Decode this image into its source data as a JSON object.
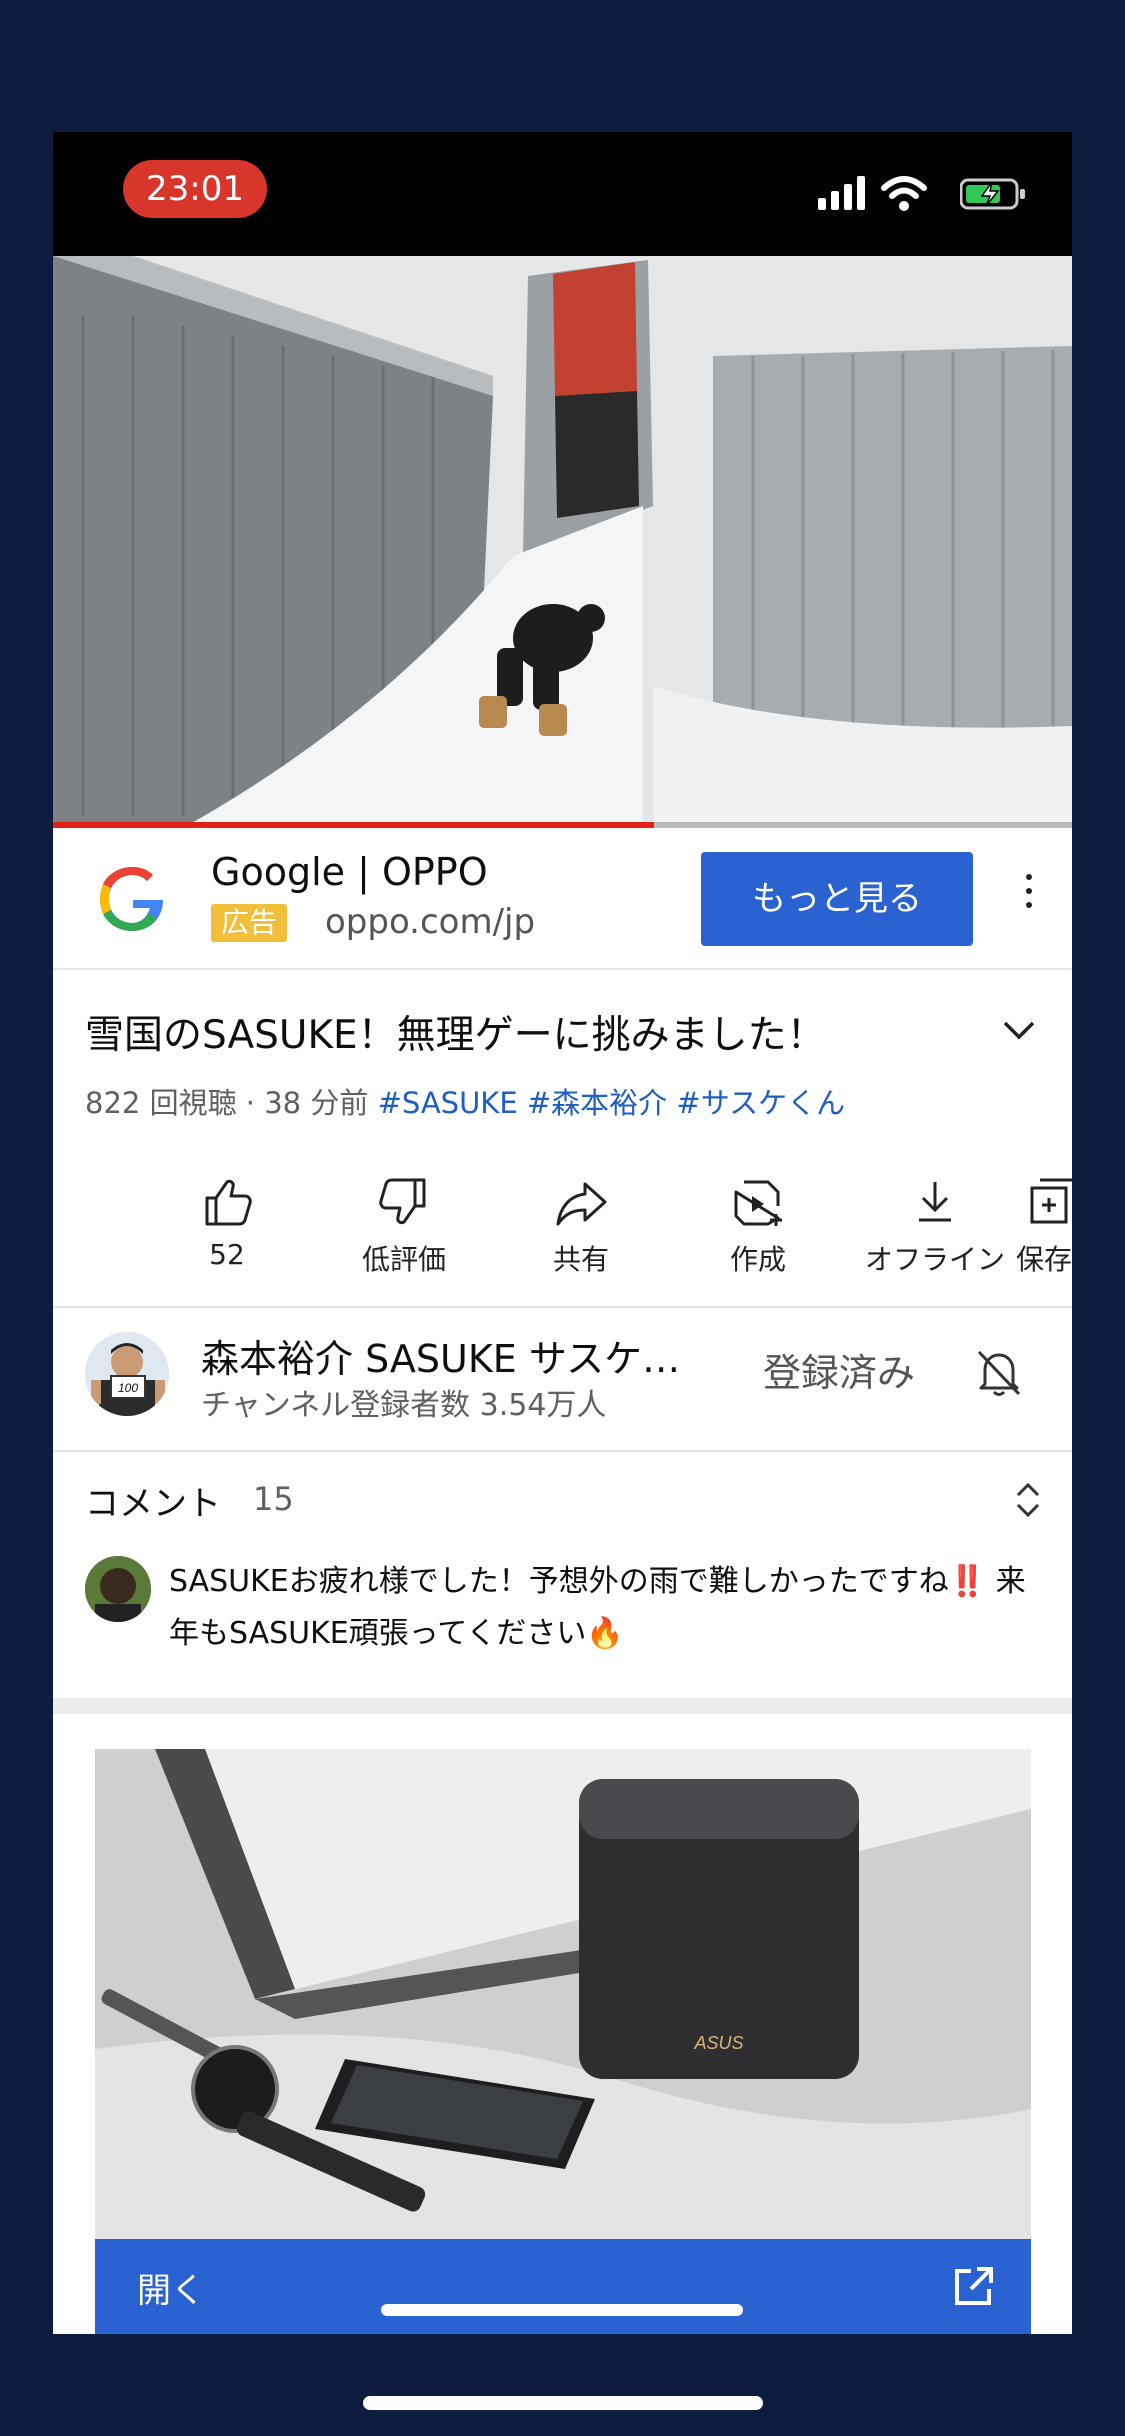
{
  "status_bar": {
    "time": "23:01",
    "icons": [
      "signal-icon",
      "wifi-icon",
      "battery-charging-icon"
    ],
    "time_pill_color": "#d8352b"
  },
  "video": {
    "progress": 0.59,
    "progress_color": "#e52016"
  },
  "ad": {
    "logo": "google-icon",
    "title": "Google | OPPO",
    "badge": "広告",
    "url": "oppo.com/jp",
    "cta": "もっと見る",
    "accent": "#2a62d1"
  },
  "title": "雪国のSASUKE！無理ゲーに挑みました！",
  "meta": {
    "views_time": "822 回視聴 · 38 分前 ",
    "tags": [
      "#SASUKE",
      "#森本裕介",
      "#サスケくん"
    ]
  },
  "actions": [
    {
      "icon": "thumbs-up-icon",
      "label": "52"
    },
    {
      "icon": "thumbs-down-icon",
      "label": "低評価"
    },
    {
      "icon": "share-icon",
      "label": "共有"
    },
    {
      "icon": "remix-icon",
      "label": "作成"
    },
    {
      "icon": "download-icon",
      "label": "オフライン"
    },
    {
      "icon": "save-icon",
      "label": "保存"
    }
  ],
  "channel": {
    "name": "森本裕介 SASUKE サスケ…",
    "subscribers": "チャンネル登録者数 3.54万人",
    "subscribed_label": "登録済み",
    "avatar_badge": "100"
  },
  "comments": {
    "label": "コメント",
    "count": "15",
    "top_comment": "SASUKEお疲れ様でした！予想外の雨で難しかったですね‼️ 来年もSASUKE頑張ってください🔥"
  },
  "product_ad": {
    "brand_mark": "ASUS",
    "open_label": "開く"
  }
}
